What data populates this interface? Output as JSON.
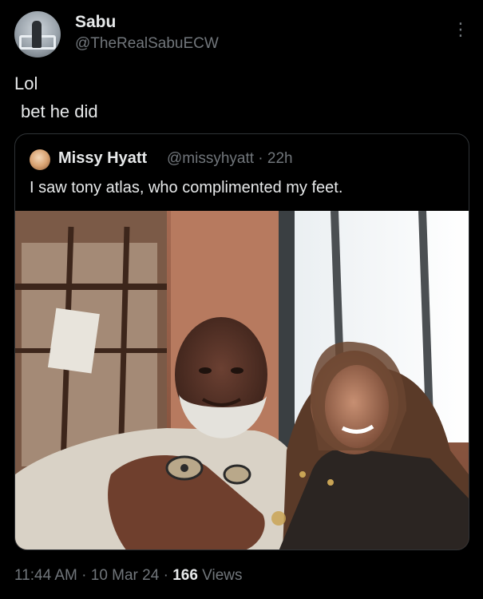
{
  "post": {
    "author_name": "Sabu",
    "author_handle": "@TheRealSabuECW",
    "more_icon": "⋮",
    "text_line1": "Lol",
    "text_line2": "bet he did"
  },
  "quoted_post": {
    "author_name": "Missy Hyatt",
    "author_handle_time": "@missyhyatt · 22h",
    "text": "I saw tony atlas, who complimented my feet."
  },
  "footer": {
    "timestamp": "11:44 AM · 10 Mar 24 · ",
    "views_count": "166",
    "views_label": " Views"
  },
  "icons": {
    "more": "more-vertical-icon"
  }
}
